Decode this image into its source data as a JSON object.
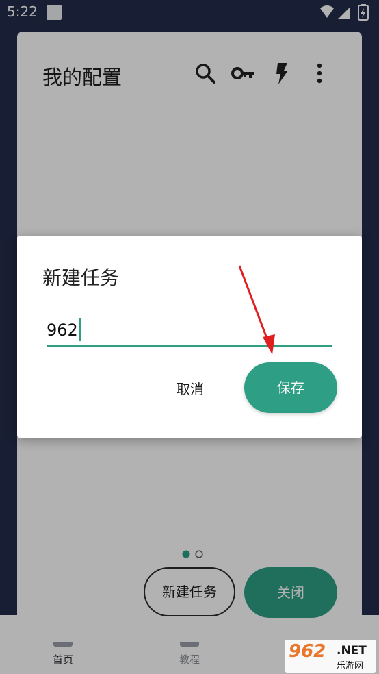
{
  "status_bar": {
    "time": "5:22",
    "icons": [
      "notification-square-icon",
      "wifi-icon",
      "signal-icon",
      "battery-charging-icon"
    ]
  },
  "app": {
    "title": "我的配置",
    "toolbar_icons": [
      "search-icon",
      "key-icon",
      "flash-icon",
      "more-vert-icon"
    ],
    "page_indicator": {
      "count": 2,
      "active_index": 0
    },
    "new_task_button": "新建任务",
    "close_button": "关闭"
  },
  "bottom_nav": {
    "items": [
      {
        "label": "首页",
        "active": true
      },
      {
        "label": "教程",
        "active": false
      }
    ]
  },
  "dialog": {
    "title": "新建任务",
    "input_value": "962",
    "cancel_label": "取消",
    "save_label": "保存"
  },
  "watermark": {
    "logo": "962",
    "net": ".NET",
    "subtitle": "乐游网"
  },
  "colors": {
    "accent": "#2e9e84",
    "background": "#232b4a",
    "arrow": "#e02020",
    "watermark_orange": "#e9762b"
  }
}
